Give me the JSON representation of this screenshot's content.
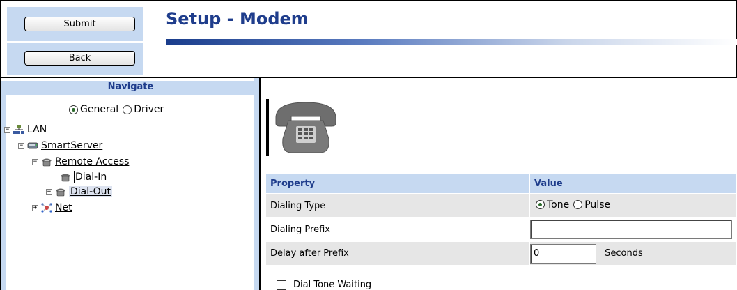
{
  "header": {
    "submit_label": "Submit",
    "back_label": "Back",
    "title": "Setup - Modem"
  },
  "navigate": {
    "title": "Navigate",
    "view_options": [
      {
        "label": "General",
        "selected": true
      },
      {
        "label": "Driver",
        "selected": false
      }
    ],
    "tree": {
      "lan": "LAN",
      "smartserver": "SmartServer",
      "remote_access": "Remote Access",
      "dial_in": "Dial-In",
      "dial_out": "Dial-Out",
      "net": "Net"
    }
  },
  "properties": {
    "header_property": "Property",
    "header_value": "Value",
    "dialing_type_label": "Dialing Type",
    "dialing_type_options": [
      {
        "label": "Tone",
        "selected": true
      },
      {
        "label": "Pulse",
        "selected": false
      }
    ],
    "dialing_prefix_label": "Dialing Prefix",
    "dialing_prefix_value": "",
    "delay_label": "Delay after Prefix",
    "delay_value": "0",
    "delay_unit": "Seconds",
    "dial_tone_waiting_label": "Dial Tone Waiting",
    "dial_tone_waiting_checked": false
  },
  "colors": {
    "title_blue": "#1f3d8c",
    "panel_blue": "#c6d9f1",
    "row_gray": "#e6e6e6"
  }
}
